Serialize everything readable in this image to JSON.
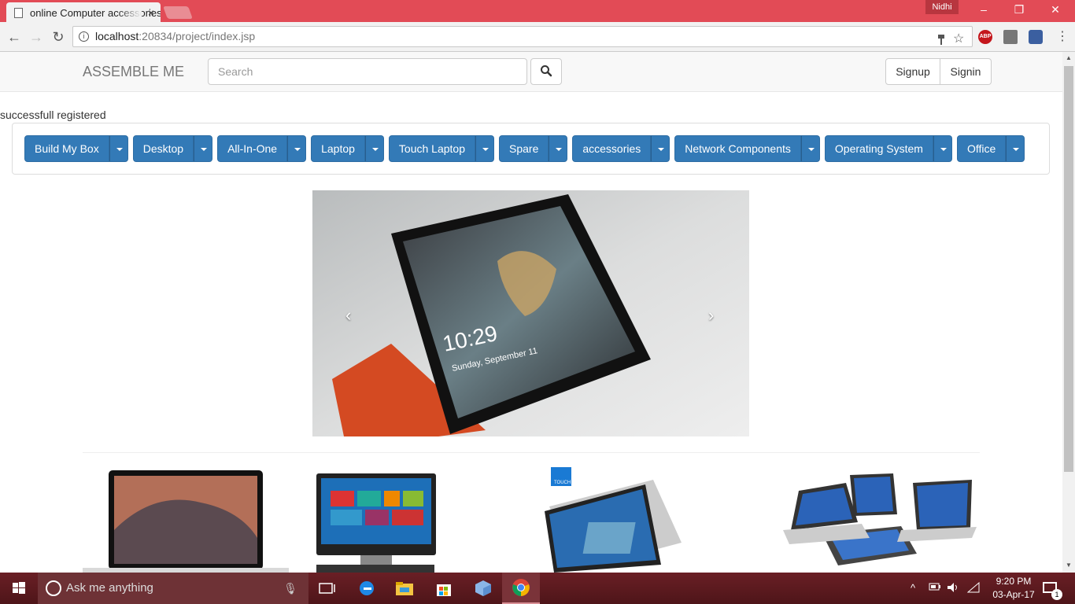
{
  "browser": {
    "tab_title": "online Computer accessories",
    "tab_close": "×",
    "user_name": "Nidhi",
    "url_host": "localhost",
    "url_path": ":20834/project/index.jsp",
    "window_buttons": {
      "minimize": "–",
      "restore": "❐",
      "close": "✕"
    },
    "nav": {
      "back": "←",
      "forward": "→",
      "reload": "↻"
    },
    "extensions": {
      "adblock": "ABP"
    }
  },
  "site": {
    "brand": "ASSEMBLE ME",
    "search_placeholder": "Search",
    "signup_label": "Signup",
    "signin_label": "Signin",
    "status_message": "successfull registered",
    "menu": [
      {
        "label": "Build My Box"
      },
      {
        "label": "Desktop"
      },
      {
        "label": "All-In-One"
      },
      {
        "label": "Laptop"
      },
      {
        "label": "Touch Laptop"
      },
      {
        "label": "Spare"
      },
      {
        "label": "accessories"
      },
      {
        "label": "Network Components"
      },
      {
        "label": "Operating System"
      },
      {
        "label": "Office"
      }
    ],
    "carousel": {
      "prev": "‹",
      "next": "›",
      "screen_time": "10:29",
      "screen_date": "Sunday, September 11"
    },
    "products": [
      {
        "name": "laptop-macbook"
      },
      {
        "name": "all-in-one-desktop"
      },
      {
        "name": "touch-laptop",
        "badge": "TOUCH"
      },
      {
        "name": "convertible-laptops"
      }
    ],
    "accent_color": "#337ab7"
  },
  "taskbar": {
    "search_placeholder": "Ask me anything",
    "time": "9:20 PM",
    "date": "03-Apr-17",
    "notification_count": "1"
  }
}
